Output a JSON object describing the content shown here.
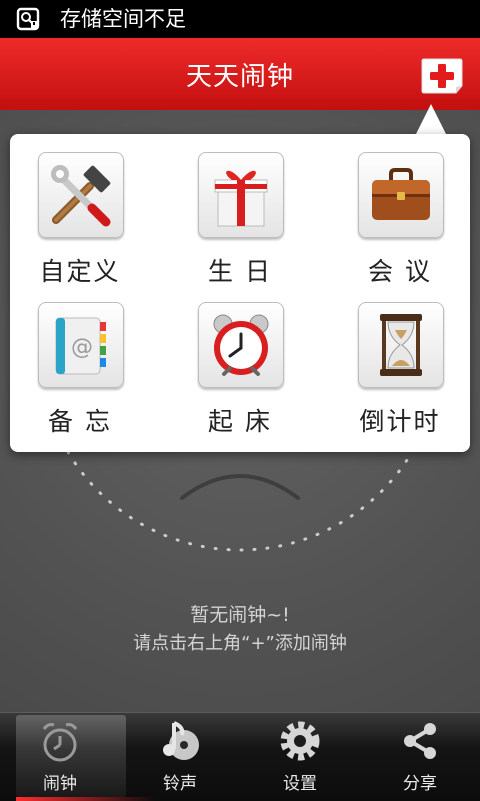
{
  "status_bar": {
    "text": "存储空间不足",
    "icon": "storage-warning-icon"
  },
  "header": {
    "title": "天天闹钟",
    "add_button_icon": "add-icon",
    "accent_color": "#e01b1b"
  },
  "popup_menu": {
    "items": [
      {
        "label": "自定义",
        "icon": "tools-icon"
      },
      {
        "label": "生 日",
        "icon": "gift-icon"
      },
      {
        "label": "会 议",
        "icon": "briefcase-icon"
      },
      {
        "label": "备 忘",
        "icon": "address-book-icon"
      },
      {
        "label": "起 床",
        "icon": "alarm-clock-icon"
      },
      {
        "label": "倒计时",
        "icon": "hourglass-icon"
      }
    ]
  },
  "empty_state": {
    "title": "暂无闹钟~!",
    "hint": "请点击右上角“+”添加闹钟"
  },
  "bottom_nav": {
    "active": "闹钟",
    "tabs": [
      {
        "label": "闹钟",
        "icon": "clock-icon"
      },
      {
        "label": "铃声",
        "icon": "music-note-icon"
      },
      {
        "label": "设置",
        "icon": "gear-icon"
      },
      {
        "label": "分享",
        "icon": "share-icon"
      }
    ]
  }
}
